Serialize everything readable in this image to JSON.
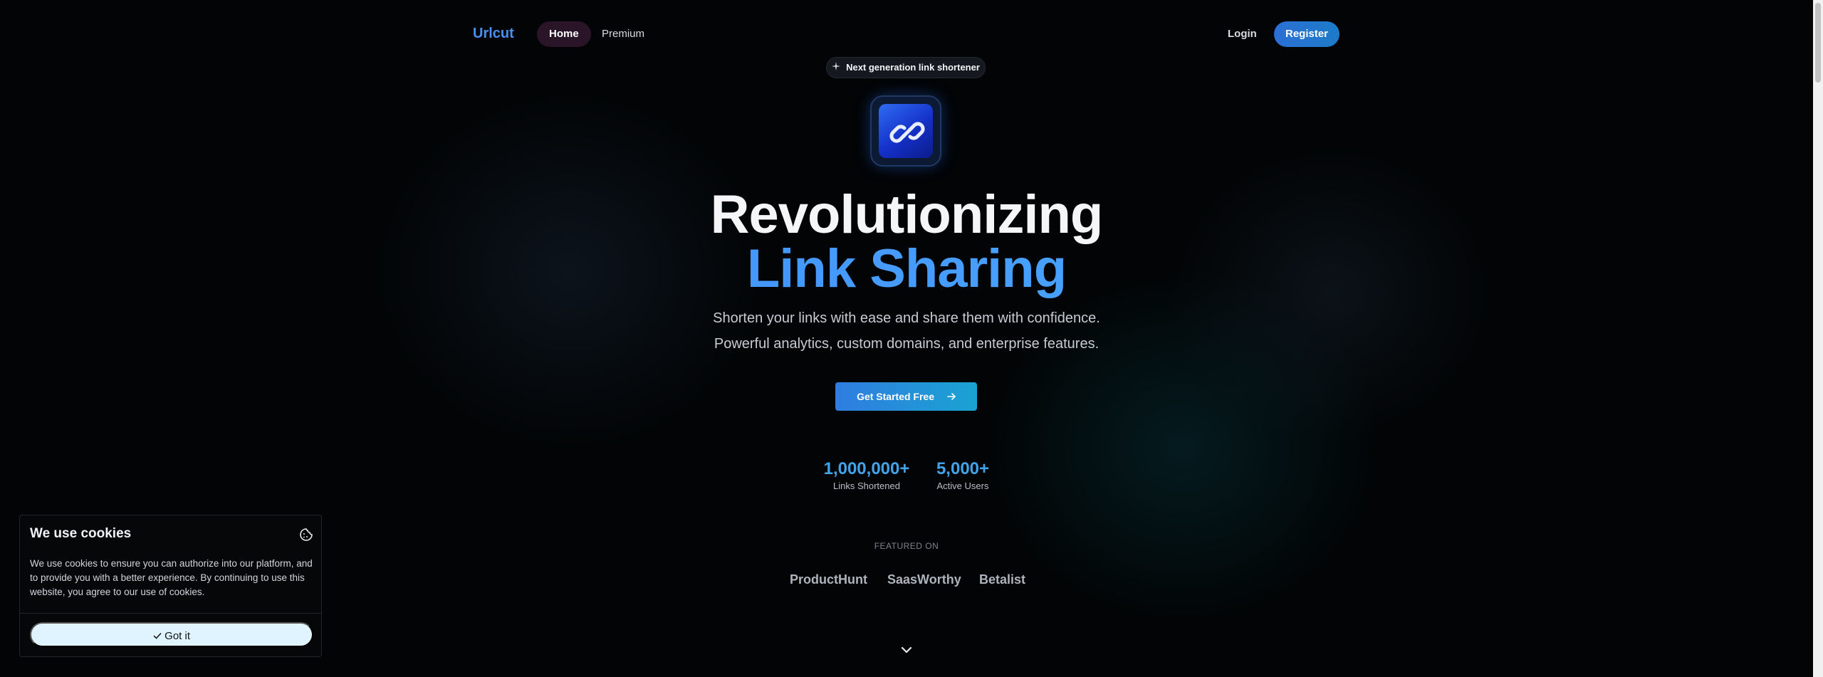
{
  "nav": {
    "logo": "Urlcut",
    "links": [
      {
        "label": "Home",
        "active": true
      },
      {
        "label": "Premium",
        "active": false
      }
    ],
    "login_label": "Login",
    "register_label": "Register"
  },
  "hero": {
    "badge": "Next generation link shortener",
    "badge_icon": "sparkles-icon",
    "app_icon": "link-icon",
    "title_line1": "Revolutionizing",
    "title_line2": "Link Sharing",
    "subtitle_line1": "Shorten your links with ease and share them with confidence.",
    "subtitle_line2": "Powerful analytics, custom domains, and enterprise features.",
    "cta_label": "Get Started Free",
    "cta_icon": "arrow-right-icon"
  },
  "stats": [
    {
      "value": "1,000,000+",
      "label": "Links Shortened"
    },
    {
      "value": "5,000+",
      "label": "Active Users"
    }
  ],
  "featured": {
    "heading": "FEATURED ON",
    "partners": [
      "ProductHunt",
      "SaasWorthy",
      "Betalist"
    ]
  },
  "scroll_icon": "chevron-down-icon",
  "cookie_banner": {
    "title": "We use cookies",
    "icon": "cookie-icon",
    "text": "We use cookies to ensure you can authorize into our platform, and to provide you with a better experience. By continuing to use this website, you agree to our use of cookies.",
    "button_label": "Got it",
    "button_icon": "check-icon"
  },
  "colors": {
    "background": "#020405",
    "accent": "#3b82f6",
    "stat_accent": "#41a4ea",
    "active_nav": "#2a1428"
  }
}
